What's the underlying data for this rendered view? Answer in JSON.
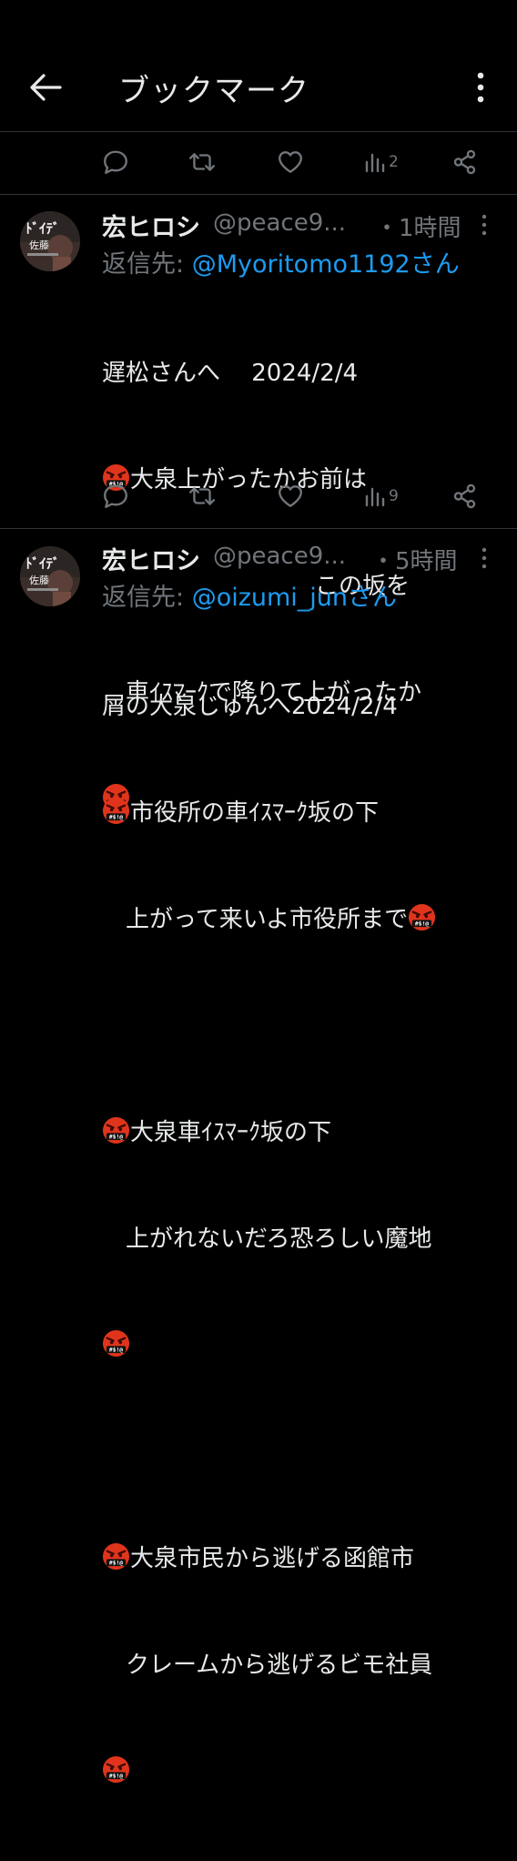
{
  "header": {
    "title": "ブックマーク"
  },
  "top_action_bar": {
    "views_count": "2"
  },
  "tweets": [
    {
      "name": "宏ヒロシ",
      "handle": "@peace9...",
      "time": "・1時間",
      "reply_prefix": "返信先: ",
      "reply_to": "@Myoritomo1192さん",
      "lines": [
        {
          "emoji": false,
          "text": "遅松さんへ　 2024/2/4"
        },
        {
          "emoji": true,
          "text": "大泉上がったかお前は"
        },
        {
          "emoji": false,
          "text": "　　　　　　　　　この坂を"
        },
        {
          "emoji": false,
          "text": "　車ｲｽﾏｰｸで降りて上がったか"
        },
        {
          "emoji": true,
          "text": ""
        }
      ],
      "views_count": "9"
    },
    {
      "name": "宏ヒロシ",
      "handle": "@peace9...",
      "time": "・5時間",
      "reply_prefix": "返信先: ",
      "reply_to": "@oizumi_junさん",
      "lines": [
        {
          "emoji": false,
          "text": "屑の大泉じゅんへ2024/2/4"
        },
        {
          "emoji": true,
          "text": "市役所の車ｲｽﾏｰｸ坂の下"
        },
        {
          "emoji": false,
          "text": "　上がって来いよ市役所まで",
          "trailing_emoji": true
        },
        {
          "emoji": false,
          "text": ""
        },
        {
          "emoji": true,
          "text": "大泉車ｲｽﾏｰｸ坂の下"
        },
        {
          "emoji": false,
          "text": "　上がれないだろ恐ろしい魔地"
        },
        {
          "emoji": true,
          "text": ""
        },
        {
          "emoji": false,
          "text": ""
        },
        {
          "emoji": true,
          "text": "大泉市民から逃げる函館市"
        },
        {
          "emoji": false,
          "text": "　クレームから逃げるビモ社員"
        },
        {
          "emoji": true,
          "text": ""
        }
      ]
    }
  ],
  "icons": {
    "back": "arrow-left-icon",
    "more": "vertical-dots-icon",
    "reply": "comment-bubble-icon",
    "repost": "repost-arrows-icon",
    "like": "heart-icon",
    "views": "bar-chart-icon",
    "share": "share-nodes-icon",
    "emoji": "face-with-symbols-on-mouth-emoji"
  },
  "colors": {
    "background": "#000000",
    "text": "#e7e9ea",
    "secondary": "#71767b",
    "link": "#1d9bf0",
    "divider": "#2f3336"
  }
}
